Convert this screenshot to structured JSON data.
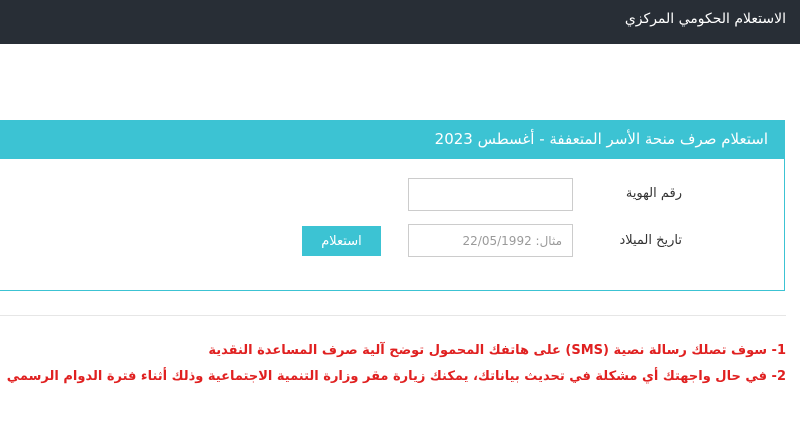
{
  "header": {
    "title": "الاستعلام الحكومي المركزي",
    "background": "#282e36"
  },
  "panel": {
    "title": "استعلام صرف منحة الأسر المتعففة - أغسطس 2023",
    "accent": "#3cc3d3"
  },
  "form": {
    "id_label": "رقم الهوية",
    "id_value": "",
    "id_placeholder": "",
    "dob_label": "تاريخ الميلاد",
    "dob_value": "",
    "dob_placeholder": "مثال: 22/05/1992",
    "submit_label": "استعلام"
  },
  "notes": [
    "1- سوف تصلك رسالة نصية (SMS) على هاتفك المحمول توضح آلية صرف المساعدة النقدية",
    "2- في حال واجهتك أي مشكلة في تحديث بياناتك، يمكنك زيارة مقر وزارة التنمية الاجتماعية وذلك أثناء فترة الدوام الرسمي"
  ],
  "colors": {
    "notes_text": "#e02020"
  }
}
